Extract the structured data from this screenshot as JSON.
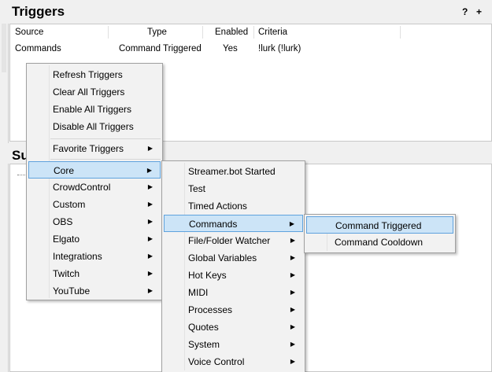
{
  "triggers": {
    "title": "Triggers",
    "help_icon": "?",
    "add_icon": "+",
    "columns": [
      "Source",
      "Type",
      "Enabled",
      "Criteria"
    ],
    "row": {
      "source": "Commands",
      "type": "Command Triggered",
      "enabled": "Yes",
      "criteria": "!lurk (!lurk)"
    }
  },
  "subactions": {
    "title_visible": "Su"
  },
  "menu1": {
    "items": [
      {
        "label": "Refresh Triggers"
      },
      {
        "label": "Clear All Triggers"
      },
      {
        "label": "Enable All Triggers"
      },
      {
        "label": "Disable All Triggers"
      },
      {
        "label": "Favorite Triggers"
      },
      {
        "label": "Core"
      },
      {
        "label": "CrowdControl"
      },
      {
        "label": "Custom"
      },
      {
        "label": "OBS"
      },
      {
        "label": "Elgato"
      },
      {
        "label": "Integrations"
      },
      {
        "label": "Twitch"
      },
      {
        "label": "YouTube"
      }
    ],
    "selected": "Core"
  },
  "menu2": {
    "items": [
      {
        "label": "Streamer.bot Started"
      },
      {
        "label": "Test"
      },
      {
        "label": "Timed Actions"
      },
      {
        "label": "Commands"
      },
      {
        "label": "File/Folder Watcher"
      },
      {
        "label": "Global Variables"
      },
      {
        "label": "Hot Keys"
      },
      {
        "label": "MIDI"
      },
      {
        "label": "Processes"
      },
      {
        "label": "Quotes"
      },
      {
        "label": "System"
      },
      {
        "label": "Voice Control"
      }
    ],
    "selected": "Commands"
  },
  "menu3": {
    "items": [
      {
        "label": "Command Triggered"
      },
      {
        "label": "Command Cooldown"
      }
    ],
    "selected": "Command Triggered"
  },
  "icons": {
    "submenu_arrow": "chevron-right-icon"
  },
  "colors": {
    "highlight_bg": "#cce4f7",
    "highlight_border": "#5fa2dd",
    "menu_bg": "#f2f2f2"
  }
}
